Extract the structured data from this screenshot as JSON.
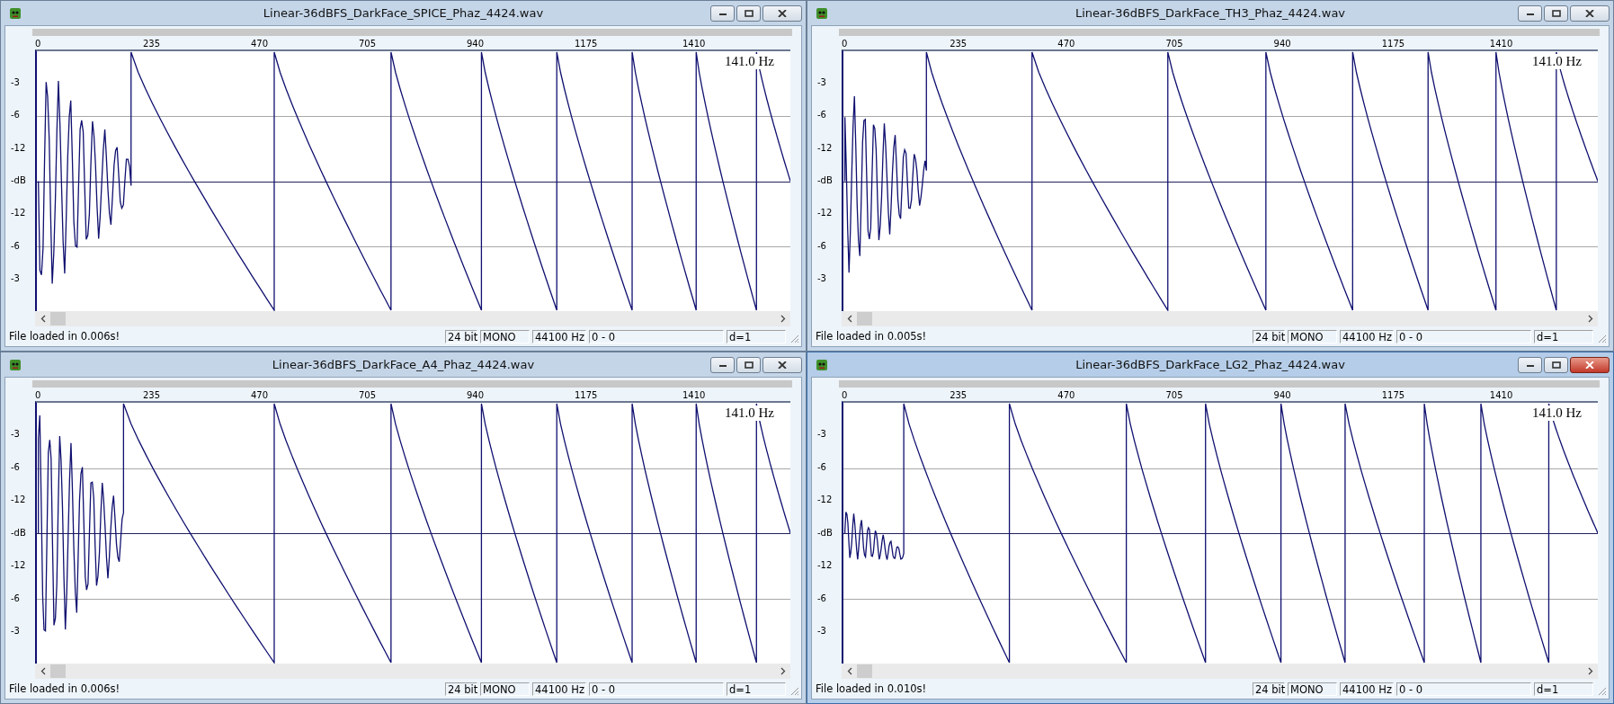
{
  "windows": [
    {
      "title": "Linear-36dBFS_DarkFace_SPICE_Phaz_4424.wav",
      "active": false,
      "ruler_labels": [
        "0",
        "235",
        "470",
        "705",
        "940",
        "1175",
        "1410"
      ],
      "frequency": "141.0 Hz",
      "axis_labels": [
        "-3",
        "-6",
        "-12",
        "-dB",
        "-12",
        "-6",
        "-3"
      ],
      "status": "File loaded in 0.006s!",
      "bit_depth": "24 bit",
      "channels": "MONO",
      "sample_rate": "44100 Hz",
      "range": "0 - 0",
      "zoom": "d=1"
    },
    {
      "title": "Linear-36dBFS_DarkFace_TH3_Phaz_4424.wav",
      "active": false,
      "ruler_labels": [
        "0",
        "235",
        "470",
        "705",
        "940",
        "1175",
        "1410"
      ],
      "frequency": "141.0 Hz",
      "axis_labels": [
        "-3",
        "-6",
        "-12",
        "-dB",
        "-12",
        "-6",
        "-3"
      ],
      "status": "File loaded in 0.005s!",
      "bit_depth": "24 bit",
      "channels": "MONO",
      "sample_rate": "44100 Hz",
      "range": "0 - 0",
      "zoom": "d=1"
    },
    {
      "title": "Linear-36dBFS_DarkFace_A4_Phaz_4424.wav",
      "active": false,
      "ruler_labels": [
        "0",
        "235",
        "470",
        "705",
        "940",
        "1175",
        "1410"
      ],
      "frequency": "141.0 Hz",
      "axis_labels": [
        "-3",
        "-6",
        "-12",
        "-dB",
        "-12",
        "-6",
        "-3"
      ],
      "status": "File loaded in 0.006s!",
      "bit_depth": "24 bit",
      "channels": "MONO",
      "sample_rate": "44100 Hz",
      "range": "0 - 0",
      "zoom": "d=1"
    },
    {
      "title": "Linear-36dBFS_DarkFace_LG2_Phaz_4424.wav",
      "active": true,
      "ruler_labels": [
        "0",
        "235",
        "470",
        "705",
        "940",
        "1175",
        "1410"
      ],
      "frequency": "141.0 Hz",
      "axis_labels": [
        "-3",
        "-6",
        "-12",
        "-dB",
        "-12",
        "-6",
        "-3"
      ],
      "status": "File loaded in 0.010s!",
      "bit_depth": "24 bit",
      "channels": "MONO",
      "sample_rate": "44100 Hz",
      "range": "0 - 0",
      "zoom": "d=1"
    }
  ]
}
